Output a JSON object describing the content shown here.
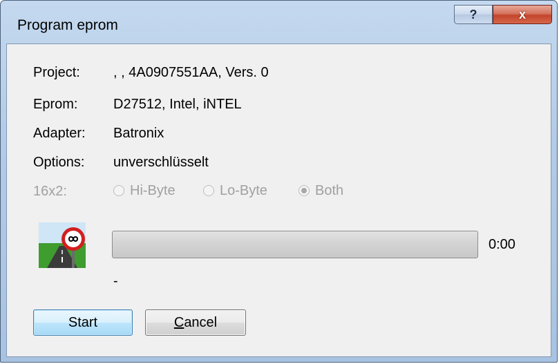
{
  "window": {
    "title": "Program eprom",
    "help_label": "?",
    "close_label": "x"
  },
  "info": {
    "project_label": "Project:",
    "project_value": ", , 4A0907551AA, Vers. 0",
    "eprom_label": "Eprom:",
    "eprom_value": "D27512, Intel, iNTEL",
    "adapter_label": "Adapter:",
    "adapter_value": "Batronix",
    "options_label": "Options:",
    "options_value": "unverschlüsselt"
  },
  "byte_mode": {
    "label": "16x2:",
    "options": [
      {
        "label": "Hi-Byte",
        "checked": false
      },
      {
        "label": "Lo-Byte",
        "checked": false
      },
      {
        "label": "Both",
        "checked": true
      }
    ],
    "enabled": false
  },
  "progress": {
    "value": 0,
    "time": "0:00"
  },
  "status_text": "-",
  "buttons": {
    "start_label": "Start",
    "cancel_label_mnemonic": "C",
    "cancel_label_rest": "ancel"
  },
  "icons": {
    "app": "no-limit-road-sign-icon"
  }
}
